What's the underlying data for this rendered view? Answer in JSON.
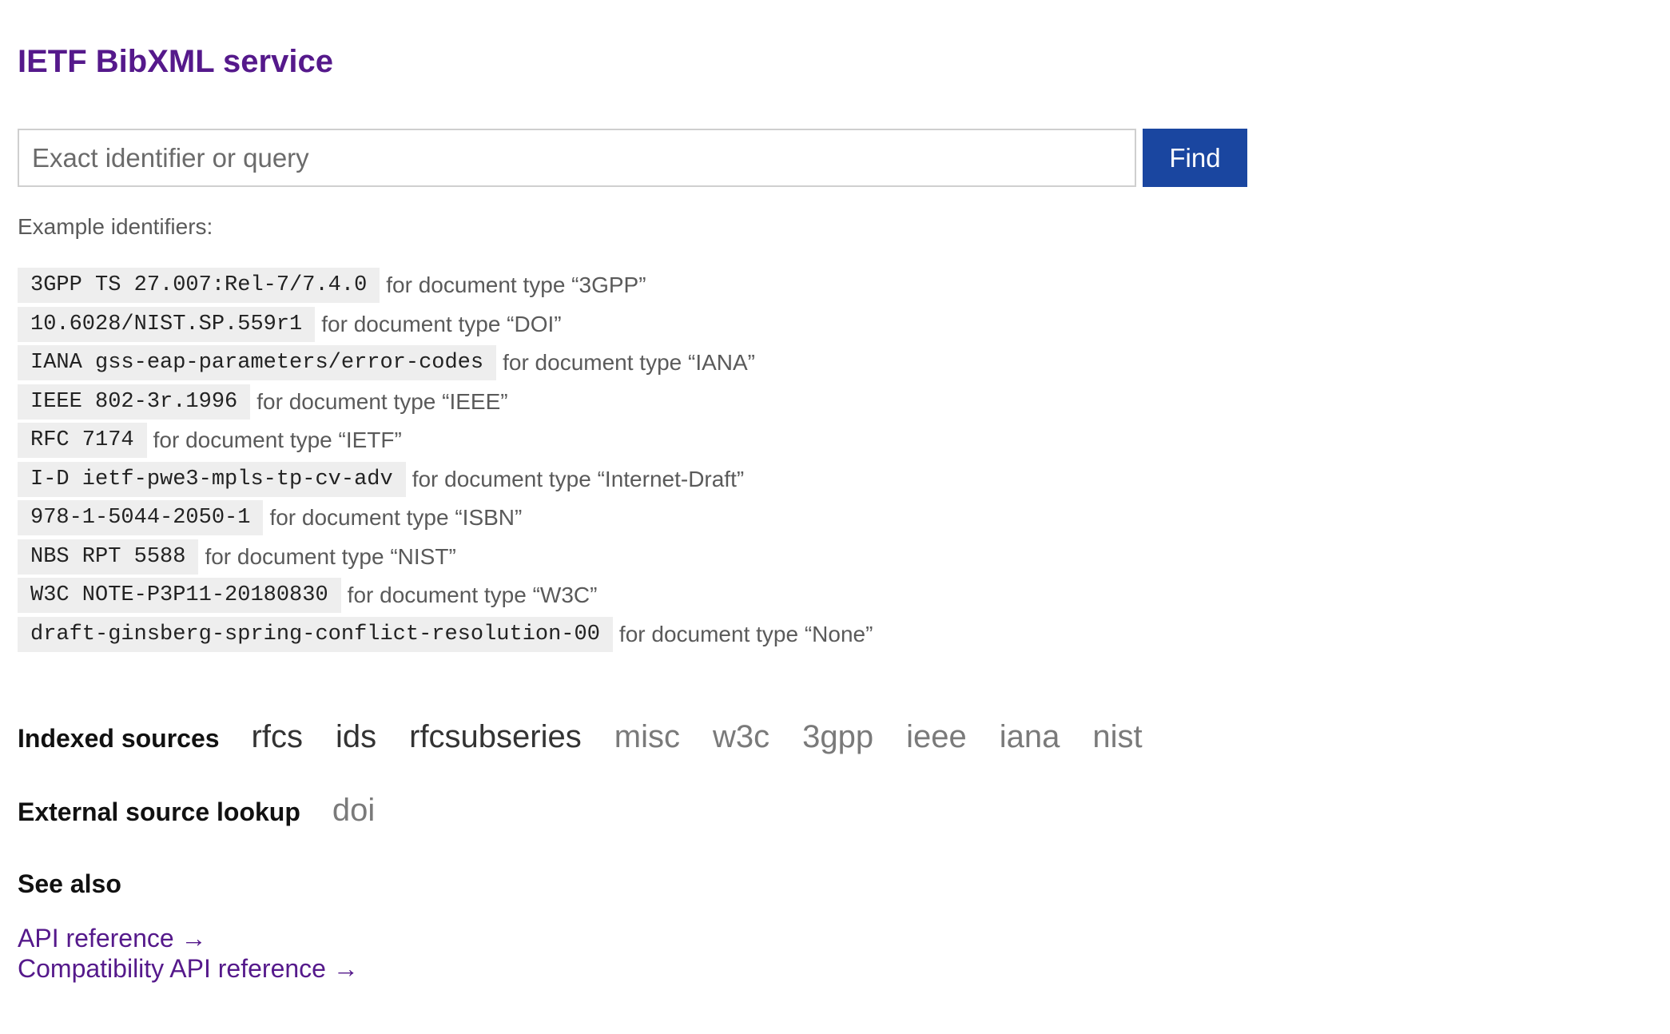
{
  "header": {
    "title": "IETF BibXML service"
  },
  "search": {
    "placeholder": "Exact identifier or query",
    "button_label": "Find"
  },
  "examples": {
    "label": "Example identifiers:",
    "items": [
      {
        "code": "3GPP TS 27.007:Rel-7/7.4.0",
        "desc": "for document type “3GPP”"
      },
      {
        "code": "10.6028/NIST.SP.559r1",
        "desc": "for document type “DOI”"
      },
      {
        "code": "IANA gss-eap-parameters/error-codes",
        "desc": "for document type “IANA”"
      },
      {
        "code": "IEEE 802-3r.1996",
        "desc": "for document type “IEEE”"
      },
      {
        "code": "RFC 7174",
        "desc": "for document type “IETF”"
      },
      {
        "code": "I-D ietf-pwe3-mpls-tp-cv-adv",
        "desc": "for document type “Internet-Draft”"
      },
      {
        "code": "978-1-5044-2050-1",
        "desc": "for document type “ISBN”"
      },
      {
        "code": "NBS RPT 5588",
        "desc": "for document type “NIST”"
      },
      {
        "code": "W3C NOTE-P3P11-20180830",
        "desc": "for document type “W3C”"
      },
      {
        "code": "draft-ginsberg-spring-conflict-resolution-00",
        "desc": "for document type “None”"
      }
    ]
  },
  "indexed_sources": {
    "heading": "Indexed sources",
    "items": [
      "rfcs",
      "ids",
      "rfcsubseries",
      "misc",
      "w3c",
      "3gpp",
      "ieee",
      "iana",
      "nist"
    ]
  },
  "external_sources": {
    "heading": "External source lookup",
    "items": [
      "doi"
    ]
  },
  "see_also": {
    "heading": "See also",
    "links": [
      "API reference →",
      "Compatibility API reference →"
    ]
  },
  "colors": {
    "title": "#55198b",
    "button": "#1a46a0",
    "link": "#55198b"
  }
}
